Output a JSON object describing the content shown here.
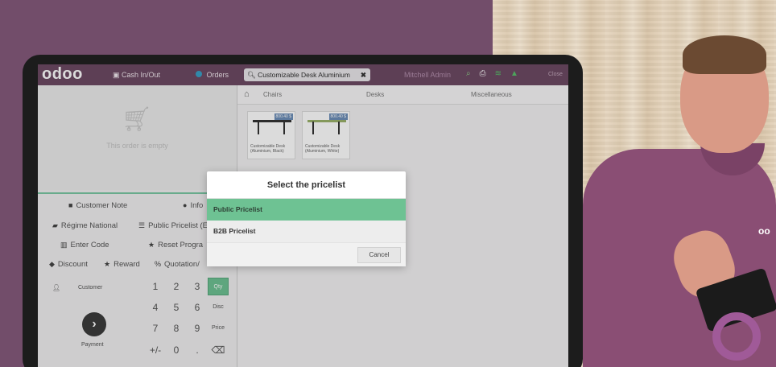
{
  "topbar": {
    "logo": "odoo",
    "cash_label": "Cash In/Out",
    "orders_label": "Orders",
    "orders_count": "1",
    "search_value": "Customizable Desk Aluminium",
    "user": "Mitchell Admin",
    "close_label": "Close"
  },
  "order": {
    "empty_text": "This order is empty"
  },
  "controls": {
    "customer_note": "Customer Note",
    "info": "Info",
    "fiscal_position": "Régime National",
    "pricelist": "Public Pricelist (E",
    "enter_code": "Enter Code",
    "reset_programs": "Reset Progra",
    "discount": "Discount",
    "reward": "Reward",
    "quotation": "Quotation/"
  },
  "numpad": {
    "customer": "Customer",
    "payment": "Payment",
    "keys": [
      "1",
      "2",
      "3",
      "Qty",
      "4",
      "5",
      "6",
      "Disc",
      "7",
      "8",
      "9",
      "Price",
      "+/-",
      "0",
      ".",
      "⌫"
    ]
  },
  "categories": [
    "Chairs",
    "Desks",
    "Miscellaneous"
  ],
  "products": [
    {
      "name": "Customizable Desk (Aluminium, Black)",
      "price": "800.40 $"
    },
    {
      "name": "Customizable Desk (Aluminium, White)",
      "price": "800.40 $"
    }
  ],
  "dialog": {
    "title": "Select the pricelist",
    "options": [
      "Public Pricelist",
      "B2B Pricelist"
    ],
    "selected": "Public Pricelist",
    "cancel": "Cancel"
  },
  "presenter": {
    "shirt_logo": "oo"
  },
  "colors": {
    "topbar": "#6d4a63",
    "accent_green": "#6ec293",
    "background": "#724d6a"
  }
}
